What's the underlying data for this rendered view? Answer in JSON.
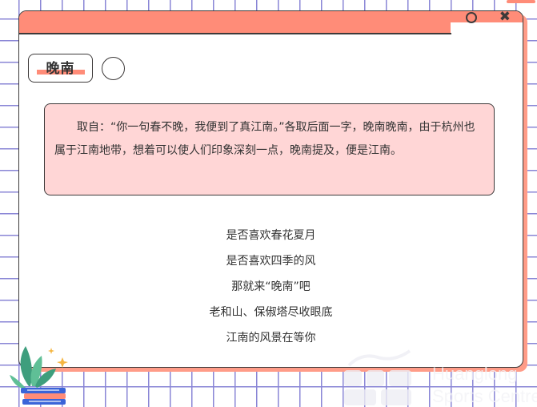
{
  "window": {
    "title": "晚南",
    "description": "取自：“你一句春不晚，我便到了真江南。”各取后面一字，晚南晚南，由于杭州也属于江南地带，想着可以使人们印象深刻一点，晚南提及，便是江南。",
    "poem": [
      "是否喜欢春花夏月",
      "是否喜欢四季的风",
      "那就来“晚南”吧",
      "老和山、保俶塔尽收眼底",
      "江南的风景在等你"
    ],
    "controls": {
      "minimize_icon": "circle-icon",
      "close_icon": "close-icon",
      "close_glyph": "✖"
    }
  },
  "watermark": {
    "line1": "Huanglong",
    "line2": "Sports Centre"
  },
  "colors": {
    "accent": "#ff8c78",
    "box_fill": "#ffd6d6",
    "grid": "#8a86d6",
    "border": "#3d3a3a"
  }
}
